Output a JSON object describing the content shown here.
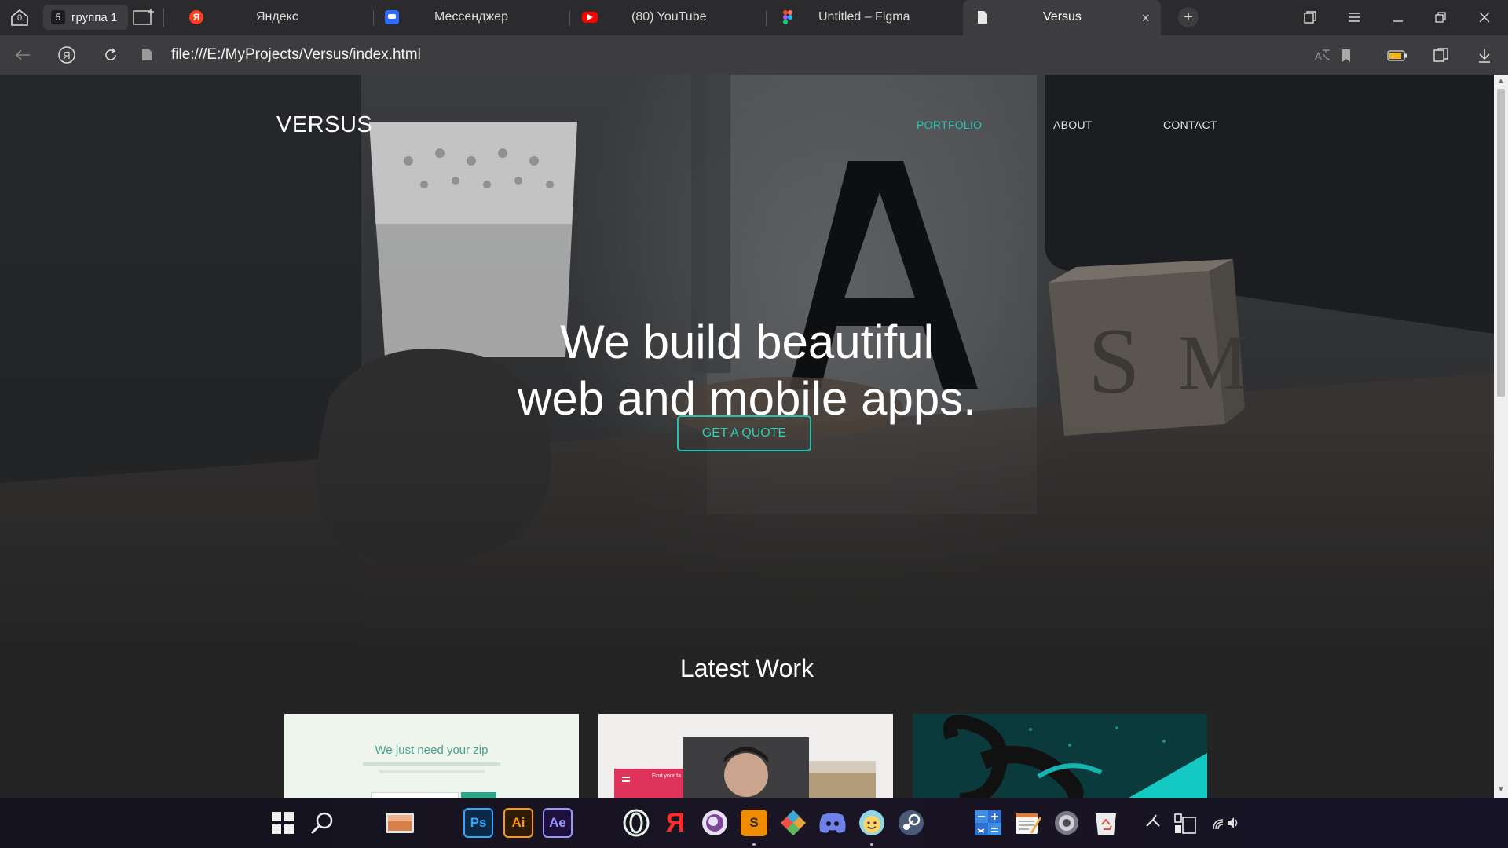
{
  "browser": {
    "home_count": "0",
    "group": {
      "count": "5",
      "label": "группа 1"
    },
    "tabs": [
      {
        "title": "Яндекс",
        "favicon": "yandex-icon",
        "color": "#fc3f1d"
      },
      {
        "title": "Мессенджер",
        "favicon": "messenger-icon",
        "color": "#2f6bff"
      },
      {
        "title": "(80) YouTube",
        "favicon": "youtube-icon",
        "color": "#ff0000"
      },
      {
        "title": "Untitled – Figma",
        "favicon": "figma-icon",
        "color": "#a259ff"
      },
      {
        "title": "Versus",
        "favicon": "file-icon",
        "active": true
      }
    ],
    "url": "file:///E:/MyProjects/Versus/index.html"
  },
  "site": {
    "brand": "VERSUS",
    "nav": [
      "PORTFOLIO",
      "ABOUT",
      "CONTACT"
    ],
    "active_nav": "PORTFOLIO",
    "hero_line1": "We build beautiful",
    "hero_line2": "web and mobile apps.",
    "cta": "GET A QUOTE",
    "section_title": "Latest Work",
    "card1_text": "We just need your zip",
    "card2_text": "Find your fa",
    "accent": "#1fc2ac"
  },
  "taskbar": {
    "apps": [
      "start-icon",
      "search-icon",
      "file-explorer-icon",
      "photoshop-icon",
      "illustrator-icon",
      "after-effects-icon",
      "opera-gx-icon",
      "yandex-browser-icon",
      "tor-icon",
      "sublime-text-icon",
      "git-icon",
      "discord-icon",
      "smiley-app-icon",
      "steam-icon",
      "calculator-icon",
      "notepad-icon",
      "settings-icon",
      "recycle-bin-icon"
    ],
    "labels": {
      "photoshop": "Ps",
      "illustrator": "Ai",
      "after_effects": "Ae",
      "sublime": "S"
    }
  }
}
